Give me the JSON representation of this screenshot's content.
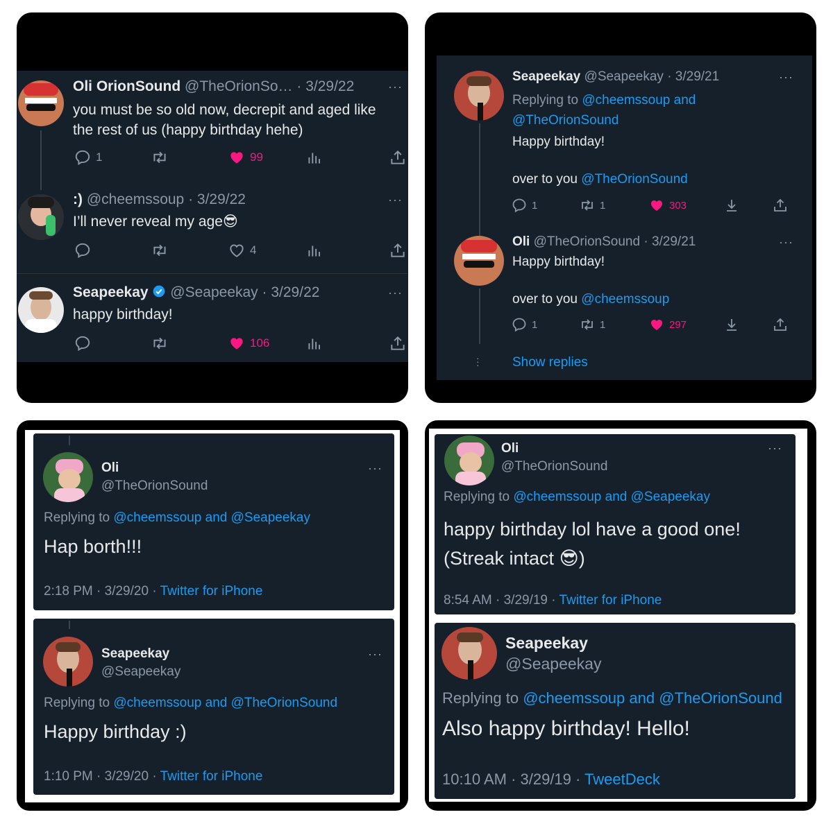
{
  "panel1": {
    "tweet1": {
      "name": "Oli OrionSound",
      "handle": "@TheOrionSo…",
      "date": "· 3/29/22",
      "line1": "you must be so old now, decrepit and aged like",
      "line2": "the rest of us (happy birthday hehe)",
      "replies": "1",
      "likes": "99"
    },
    "tweet2": {
      "name": ":)",
      "handle": "@cheemssoup",
      "date": "· 3/29/22",
      "text": "I’ll never reveal my age",
      "emoji": "😎",
      "likes": "4"
    },
    "tweet3": {
      "name": "Seapeekay",
      "handle": "@Seapeekay",
      "date": "· 3/29/22",
      "text": "happy birthday!",
      "likes": "106"
    }
  },
  "panel2": {
    "tweet1": {
      "name": "Seapeekay",
      "handle": "@Seapeekay",
      "date": "· 3/29/21",
      "replying_prefix": "Replying to",
      "replying_line1": "@cheemssoup and",
      "replying_line2": "@TheOrionSound",
      "text1": "Happy birthday!",
      "text2_prefix": "over to you",
      "text2_mention": "@TheOrionSound",
      "replies": "1",
      "retweets": "1",
      "likes": "303"
    },
    "tweet2": {
      "name": "Oli",
      "handle": "@TheOrionSound",
      "date": "· 3/29/21",
      "text1": "Happy birthday!",
      "text2_prefix": "over to you",
      "text2_mention": "@cheemssoup",
      "replies": "1",
      "retweets": "1",
      "likes": "297"
    },
    "show_replies": "Show replies"
  },
  "panel3": {
    "tweet1": {
      "name": "Oli",
      "handle": "@TheOrionSound",
      "replying_prefix": "Replying to",
      "replying_mentions": "@cheemssoup and @Seapeekay",
      "text": "Hap borth!!!",
      "time": "2:18 PM · 3/29/20 ·",
      "source": "Twitter for iPhone"
    },
    "tweet2": {
      "name": "Seapeekay",
      "handle": "@Seapeekay",
      "replying_prefix": "Replying to",
      "replying_mentions": "@cheemssoup and @TheOrionSound",
      "text": "Happy birthday :)",
      "time": "1:10 PM · 3/29/20 ·",
      "source": "Twitter for iPhone"
    }
  },
  "panel4": {
    "tweet1": {
      "name": "Oli",
      "handle": "@TheOrionSound",
      "replying_prefix": "Replying to",
      "replying_mentions": "@cheemssoup and @Seapeekay",
      "line1": "happy birthday lol have a good one!",
      "line2_a": "(Streak intact",
      "emoji": "😎",
      "line2_b": ")",
      "time": "8:54 AM · 3/29/19 ·",
      "source": "Twitter for iPhone"
    },
    "tweet2": {
      "name": "Seapeekay",
      "handle": "@Seapeekay",
      "replying_prefix": "Replying to",
      "replying_mentions": "@cheemssoup and @TheOrionSound",
      "text": "Also happy birthday! Hello!",
      "time": "10:10 AM · 3/29/19 ·",
      "source": "TweetDeck"
    }
  },
  "colors": {
    "bg": "#15202b",
    "accent": "#1d9bf0",
    "like": "#f91880",
    "muted": "#8b98a5"
  }
}
